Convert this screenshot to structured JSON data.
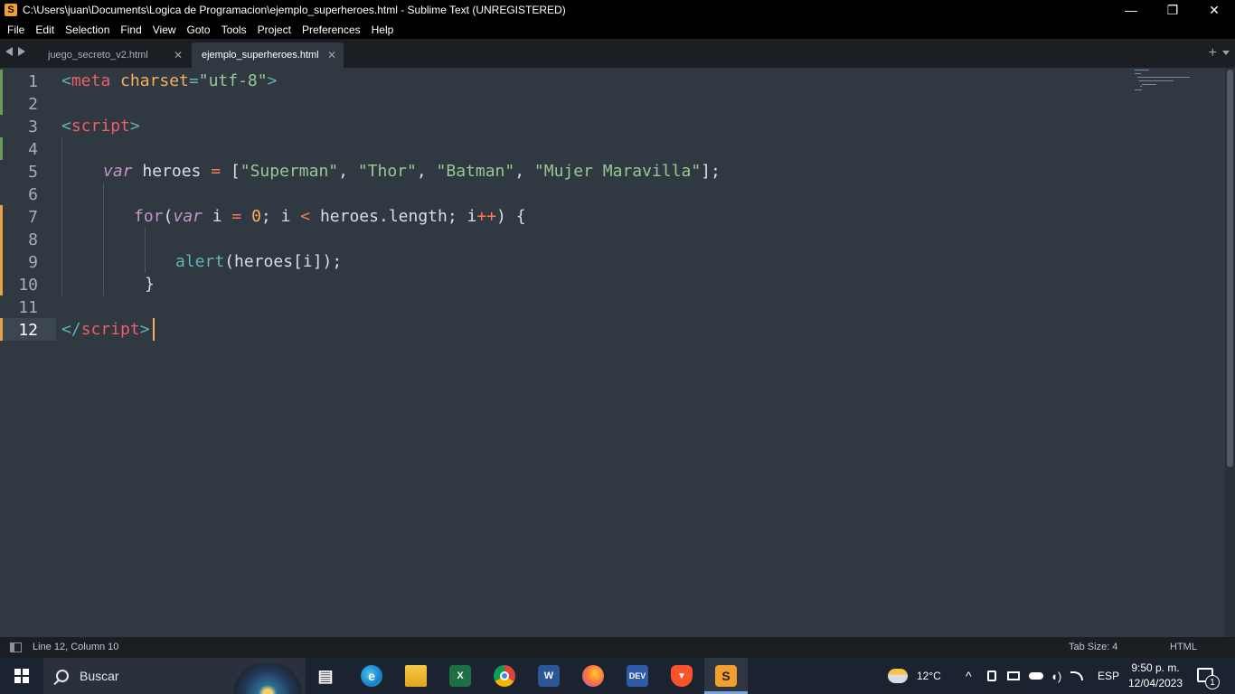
{
  "window": {
    "title": "C:\\Users\\juan\\Documents\\Logica de Programacion\\ejemplo_superheroes.html - Sublime Text (UNREGISTERED)",
    "app_icon": "S",
    "minimize": "—",
    "maximize": "❐",
    "close": "✕"
  },
  "menu": [
    "File",
    "Edit",
    "Selection",
    "Find",
    "View",
    "Goto",
    "Tools",
    "Project",
    "Preferences",
    "Help"
  ],
  "tabs": [
    {
      "label": "juego_secreto_v2.html",
      "active": false,
      "close": "✕"
    },
    {
      "label": "ejemplo_superheroes.html",
      "active": true,
      "close": "✕"
    }
  ],
  "tab_plus": "+",
  "editor": {
    "line_numbers": [
      "1",
      "2",
      "3",
      "4",
      "5",
      "6",
      "7",
      "8",
      "9",
      "10",
      "11",
      "12"
    ],
    "current_line": "12",
    "code": {
      "l1": {
        "open": "<",
        "tag": "meta",
        "attr": " charset",
        "eq": "=",
        "val": "\"utf-8\"",
        "close": ">"
      },
      "l3": {
        "open": "<",
        "tag": "script",
        "close": ">"
      },
      "l5": {
        "kw": "var",
        "name": " heroes ",
        "eq": "=",
        "open": " [",
        "s1": "\"Superman\"",
        "c1": ", ",
        "s2": "\"Thor\"",
        "c2": ", ",
        "s3": "\"Batman\"",
        "c3": ", ",
        "s4": "\"Mujer Maravilla\"",
        "close": "];"
      },
      "l7": {
        "for": "for",
        "p1": "(",
        "kw": "var",
        "i": " i ",
        "eq": "=",
        "sp": " ",
        "zero": "0",
        "semi": "; i ",
        "lt": "<",
        "len": " heroes.length; i",
        "inc": "++",
        "end": ") {"
      },
      "l9": {
        "fn": "alert",
        "args": "(heroes[i]);"
      },
      "l10": {
        "brace": "}"
      },
      "l12": {
        "open": "</",
        "tag": "script",
        "close": ">"
      }
    }
  },
  "status": {
    "position": "Line 12, Column 10",
    "tab_size": "Tab Size: 4",
    "syntax": "HTML"
  },
  "taskbar": {
    "search_placeholder": "Buscar",
    "apps": [
      {
        "icon": "task-view-icon",
        "glyph": "▤"
      },
      {
        "icon": "edge-icon",
        "glyph": "e"
      },
      {
        "icon": "file-explorer-icon",
        "glyph": ""
      },
      {
        "icon": "excel-icon",
        "glyph": "X"
      },
      {
        "icon": "chrome-icon",
        "glyph": ""
      },
      {
        "icon": "word-icon",
        "glyph": "W"
      },
      {
        "icon": "firefox-icon",
        "glyph": ""
      },
      {
        "icon": "dev-icon",
        "glyph": "DEV"
      },
      {
        "icon": "brave-icon",
        "glyph": "▼"
      },
      {
        "icon": "sublime-icon",
        "glyph": "S"
      }
    ],
    "weather_temp": "12°C",
    "tray_chevron": "^",
    "language": "ESP",
    "time": "9:50 p. m.",
    "date": "12/04/2023",
    "notifications": "1"
  }
}
